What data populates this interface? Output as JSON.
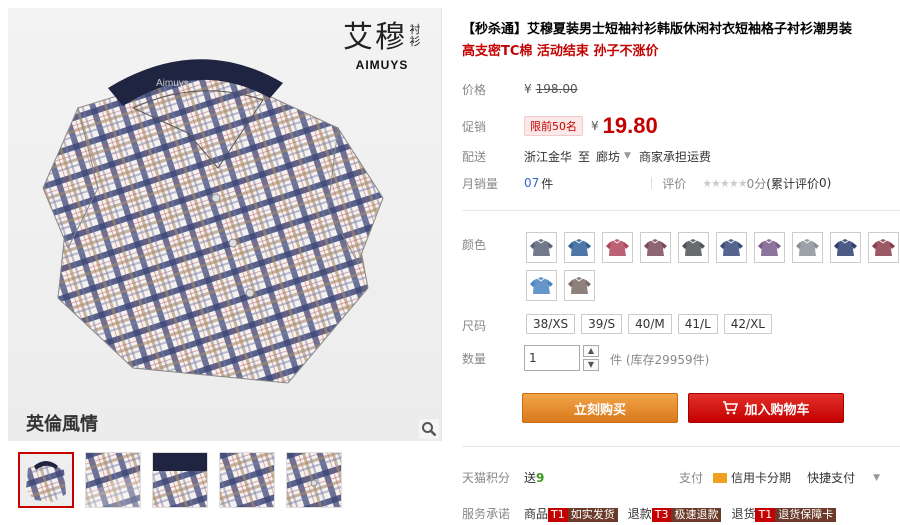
{
  "brand": {
    "name_cn": "艾穆",
    "name_cn_side": "衬衫",
    "name_en": "AIMUYS",
    "collar_tag": "Aimuys",
    "tagline": "英倫風情"
  },
  "product": {
    "title": "【秒杀通】艾穆夏装男士短袖衬衫韩版休闲衬衣短袖格子衬衫潮男装",
    "subtitle": "高支密TC棉 活动结束 孙子不涨价"
  },
  "price": {
    "orig_label": "价格",
    "orig_currency": "¥",
    "orig_value": "198.00",
    "promo_label": "促销",
    "promo_tag": "限前50名",
    "promo_currency": "¥",
    "promo_value": "19.80"
  },
  "shipping": {
    "label": "配送",
    "from": "浙江金华",
    "to_word": "至",
    "dest": "廊坊",
    "fee": "商家承担运费"
  },
  "sales": {
    "label": "月销量",
    "count": "07",
    "unit": "件",
    "rate_label": "评价",
    "stars": "★★★★★",
    "score": "0分",
    "cum_label": "(累计评价",
    "cum_count": "0)"
  },
  "options": {
    "color_label": "颜色",
    "colors": [
      {
        "name": "navy-grey check",
        "color": "#5a6276"
      },
      {
        "name": "blue check",
        "color": "#2e5f96"
      },
      {
        "name": "red check",
        "color": "#b0465c"
      },
      {
        "name": "wine check",
        "color": "#7a4a5c"
      },
      {
        "name": "grey check",
        "color": "#4e5258"
      },
      {
        "name": "dark blue check",
        "color": "#3a4a7a"
      },
      {
        "name": "purple check",
        "color": "#7a5a8a"
      },
      {
        "name": "light grey check",
        "color": "#8a9098"
      },
      {
        "name": "deep blue check",
        "color": "#2c3e6e"
      },
      {
        "name": "maroon check",
        "color": "#8a3c4a"
      },
      {
        "name": "sky blue check",
        "color": "#4a84c0"
      },
      {
        "name": "brown check",
        "color": "#7a6a66"
      }
    ],
    "size_label": "尺码",
    "sizes": [
      "38/XS",
      "39/S",
      "40/M",
      "41/L",
      "42/XL"
    ]
  },
  "quantity": {
    "label": "数量",
    "value": "1",
    "stock": "件 (库存29959件)",
    "up_icon": "chevron-up-icon",
    "down_icon": "chevron-down-icon"
  },
  "actions": {
    "buy_label": "立刻购买",
    "cart_label": "加入购物车"
  },
  "points": {
    "label": "天猫积分",
    "value_prefix": "送",
    "value": "9",
    "pay_label": "支付",
    "pay_credit": "信用卡分期",
    "pay_quick": "快捷支付"
  },
  "service": {
    "label": "服务承诺",
    "items": [
      {
        "prefix": "商品",
        "badge": "T1",
        "badge_text": "如实发货"
      },
      {
        "prefix": "退款",
        "badge": "T3",
        "badge_text": "极速退款"
      },
      {
        "prefix": "退货",
        "badge": "T1",
        "badge_text": "退货保障卡"
      }
    ]
  },
  "colors": {
    "accent_red": "#c40000",
    "buy_orange": "#e8932a",
    "link_blue": "#3366cc"
  }
}
